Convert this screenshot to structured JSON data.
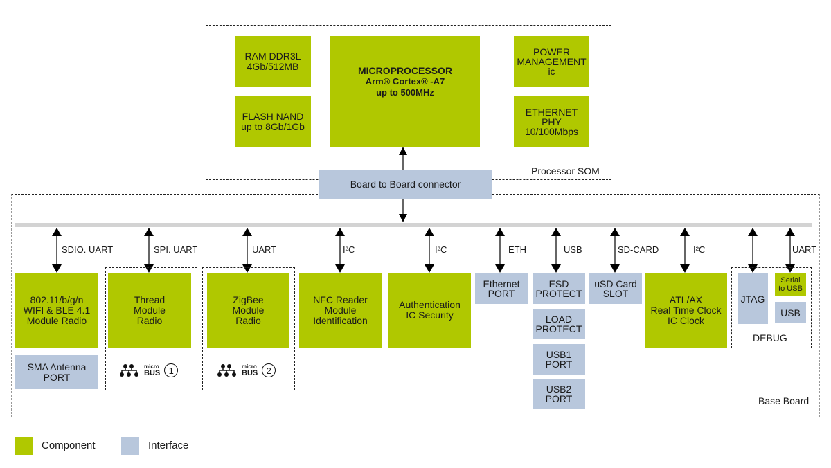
{
  "colors": {
    "component": "#b0c800",
    "interface": "#b8c7dc",
    "bus": "#d3d3d3"
  },
  "processor_som": {
    "title": "Processor SOM",
    "ram": "RAM DDR3L\n4Gb/512MB",
    "flash": "FLASH NAND\nup to 8Gb/1Gb",
    "mcu": {
      "line1": "MICROPROCESSOR",
      "line2": "Arm® Cortex® -A7",
      "line3": "up to 500MHz"
    },
    "power": "POWER\nMANAGEMENT\nic",
    "ethernet_phy": "ETHERNET\nPHY\n10/100Mbps"
  },
  "connector": "Board to Board connector",
  "base_board": {
    "title": "Base Board",
    "links": [
      {
        "label": "SDIO. UART"
      },
      {
        "label": "SPI. UART"
      },
      {
        "label": "UART"
      },
      {
        "label": "I²C"
      },
      {
        "label": "I²C"
      },
      {
        "label": "ETH"
      },
      {
        "label": "USB"
      },
      {
        "label": "SD-CARD"
      },
      {
        "label": "I²C"
      },
      {
        "label": "UART"
      }
    ],
    "wifi": "802.11/b/g/n\nWIFI & BLE 4.1\nModule Radio",
    "sma": "SMA Antenna\nPORT",
    "thread": "Thread\nModule\nRadio",
    "zigbee": "ZigBee\nModule\nRadio",
    "microbus": {
      "small": "micro",
      "big": "BUS",
      "slot1": "1",
      "slot2": "2"
    },
    "nfc": "NFC Reader\nModule\nIdentification",
    "auth": "Authentication\nIC Security",
    "eth_port": "Ethernet\nPORT",
    "usb_chain": [
      "ESD\nPROTECT",
      "LOAD\nPROTECT",
      "USB1\nPORT",
      "USB2\nPORT"
    ],
    "usd": "uSD Card\nSLOT",
    "rtc": "ATL/AX\nReal Time Clock\nIC Clock",
    "debug": {
      "title": "DEBUG",
      "jtag": "JTAG",
      "serial": "Serial\nto USB",
      "usb": "USB"
    }
  },
  "legend": [
    {
      "label": "Component",
      "kind": "component"
    },
    {
      "label": "Interface",
      "kind": "interface"
    }
  ]
}
